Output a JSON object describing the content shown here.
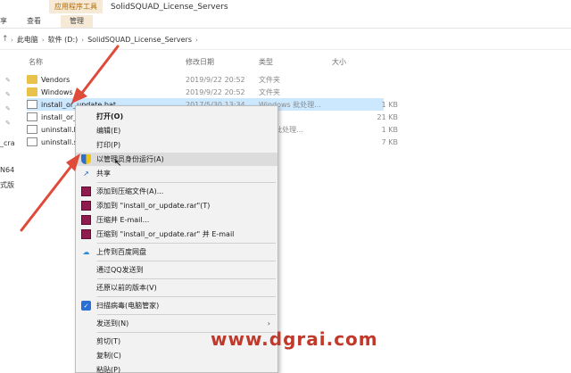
{
  "ribbon": {
    "tool_tab_header": "应用程序工具",
    "window_title": "SolidSQUAD_License_Servers",
    "tabs": [
      "享",
      "查看",
      "管理"
    ]
  },
  "address": {
    "crumbs": [
      "此电脑",
      "软件 (D:)",
      "SolidSQUAD_License_Servers"
    ]
  },
  "columns": [
    "名称",
    "修改日期",
    "类型",
    "大小"
  ],
  "left_pane": [
    "_cra",
    "N64",
    "式版"
  ],
  "files": [
    {
      "name": "Vendors",
      "date": "2019/9/22 20:52",
      "type": "文件夹",
      "size": "",
      "kind": "folder"
    },
    {
      "name": "Windows",
      "date": "2019/9/22 20:52",
      "type": "文件夹",
      "size": "",
      "kind": "folder"
    },
    {
      "name": "install_or_update.bat",
      "date": "2017/5/30 13:34",
      "type": "Windows 批处理...",
      "size": "1 KB",
      "kind": "file",
      "selected": true
    },
    {
      "name": "install_or_",
      "date": "",
      "type": "",
      "size": "21 KB",
      "kind": "file"
    },
    {
      "name": "uninstall.b",
      "date": "",
      "type": "ows 批处理...",
      "size": "1 KB",
      "kind": "file"
    },
    {
      "name": "uninstall.s",
      "date": "",
      "type": "",
      "size": "7 KB",
      "kind": "file"
    }
  ],
  "context_menu": {
    "items": [
      {
        "label": "打开(O)",
        "icon": "none",
        "bold": true
      },
      {
        "label": "编辑(E)",
        "icon": "none"
      },
      {
        "label": "打印(P)",
        "icon": "none"
      },
      {
        "label": "以管理员身份运行(A)",
        "icon": "uac-shield-icon",
        "highlighted": true
      },
      {
        "label": "共享",
        "icon": "share-icon"
      },
      {
        "label": "添加到压缩文件(A)...",
        "icon": "winrar-icon"
      },
      {
        "label": "添加到 \"install_or_update.rar\"(T)",
        "icon": "winrar-icon"
      },
      {
        "label": "压缩并 E-mail...",
        "icon": "winrar-icon"
      },
      {
        "label": "压缩到 \"install_or_update.rar\" 并 E-mail",
        "icon": "winrar-icon"
      },
      {
        "label": "上传到百度网盘",
        "icon": "baidu-netdisk-icon"
      },
      {
        "label": "通过QQ发送到",
        "icon": "none"
      },
      {
        "label": "还原以前的版本(V)",
        "icon": "none"
      },
      {
        "label": "扫描病毒(电脑管家)",
        "icon": "virus-scan-icon"
      },
      {
        "label": "发送到(N)",
        "icon": "none",
        "submenu": true
      },
      {
        "label": "剪切(T)",
        "icon": "none"
      },
      {
        "label": "复制(C)",
        "icon": "none"
      },
      {
        "label": "粘贴(P)",
        "icon": "none"
      }
    ]
  },
  "watermark": "www.dgrai.com",
  "colors": {
    "selection": "#cce8ff",
    "tool_tab": "#f6ead7",
    "arrow": "#e04a3a",
    "watermark": "#c0392b"
  }
}
